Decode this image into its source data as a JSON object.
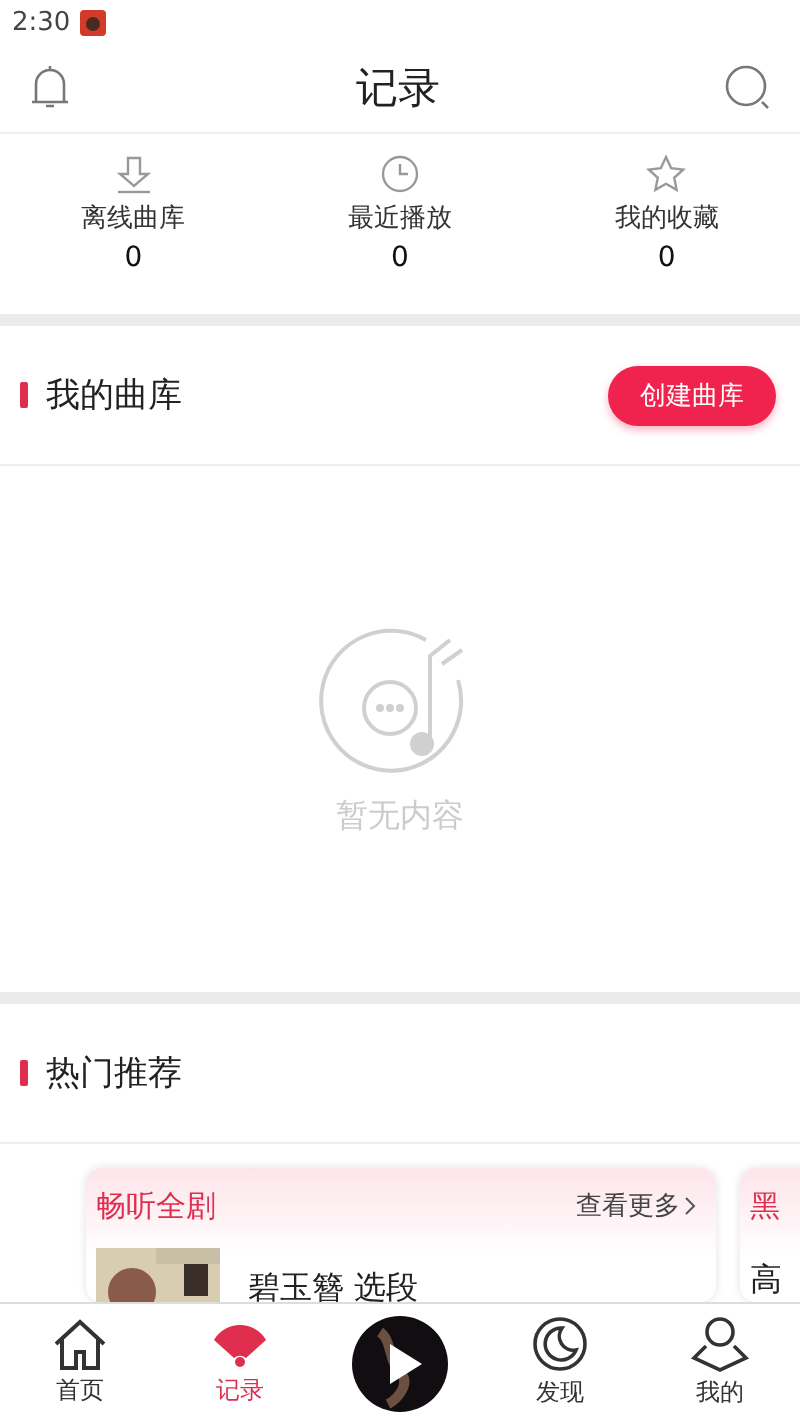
{
  "status_bar": {
    "time": "2:30"
  },
  "header": {
    "title": "记录"
  },
  "stats": [
    {
      "label": "离线曲库",
      "count": "0"
    },
    {
      "label": "最近播放",
      "count": "0"
    },
    {
      "label": "我的收藏",
      "count": "0"
    }
  ],
  "my_library": {
    "title": "我的曲库",
    "button": "创建曲库",
    "empty_text": "暂无内容"
  },
  "hot": {
    "title": "热门推荐",
    "cards": [
      {
        "title": "畅听全剧",
        "more": "查看更多",
        "item": "碧玉簪 选段"
      },
      {
        "title": "黑",
        "item": "高"
      }
    ]
  },
  "tab_bar": [
    {
      "kind": "tab",
      "label": "首页",
      "selected": false
    },
    {
      "kind": "tab",
      "label": "记录",
      "selected": true
    },
    {
      "kind": "player"
    },
    {
      "kind": "tab",
      "label": "发现",
      "selected": false
    },
    {
      "kind": "tab",
      "label": "我的",
      "selected": false
    }
  ]
}
